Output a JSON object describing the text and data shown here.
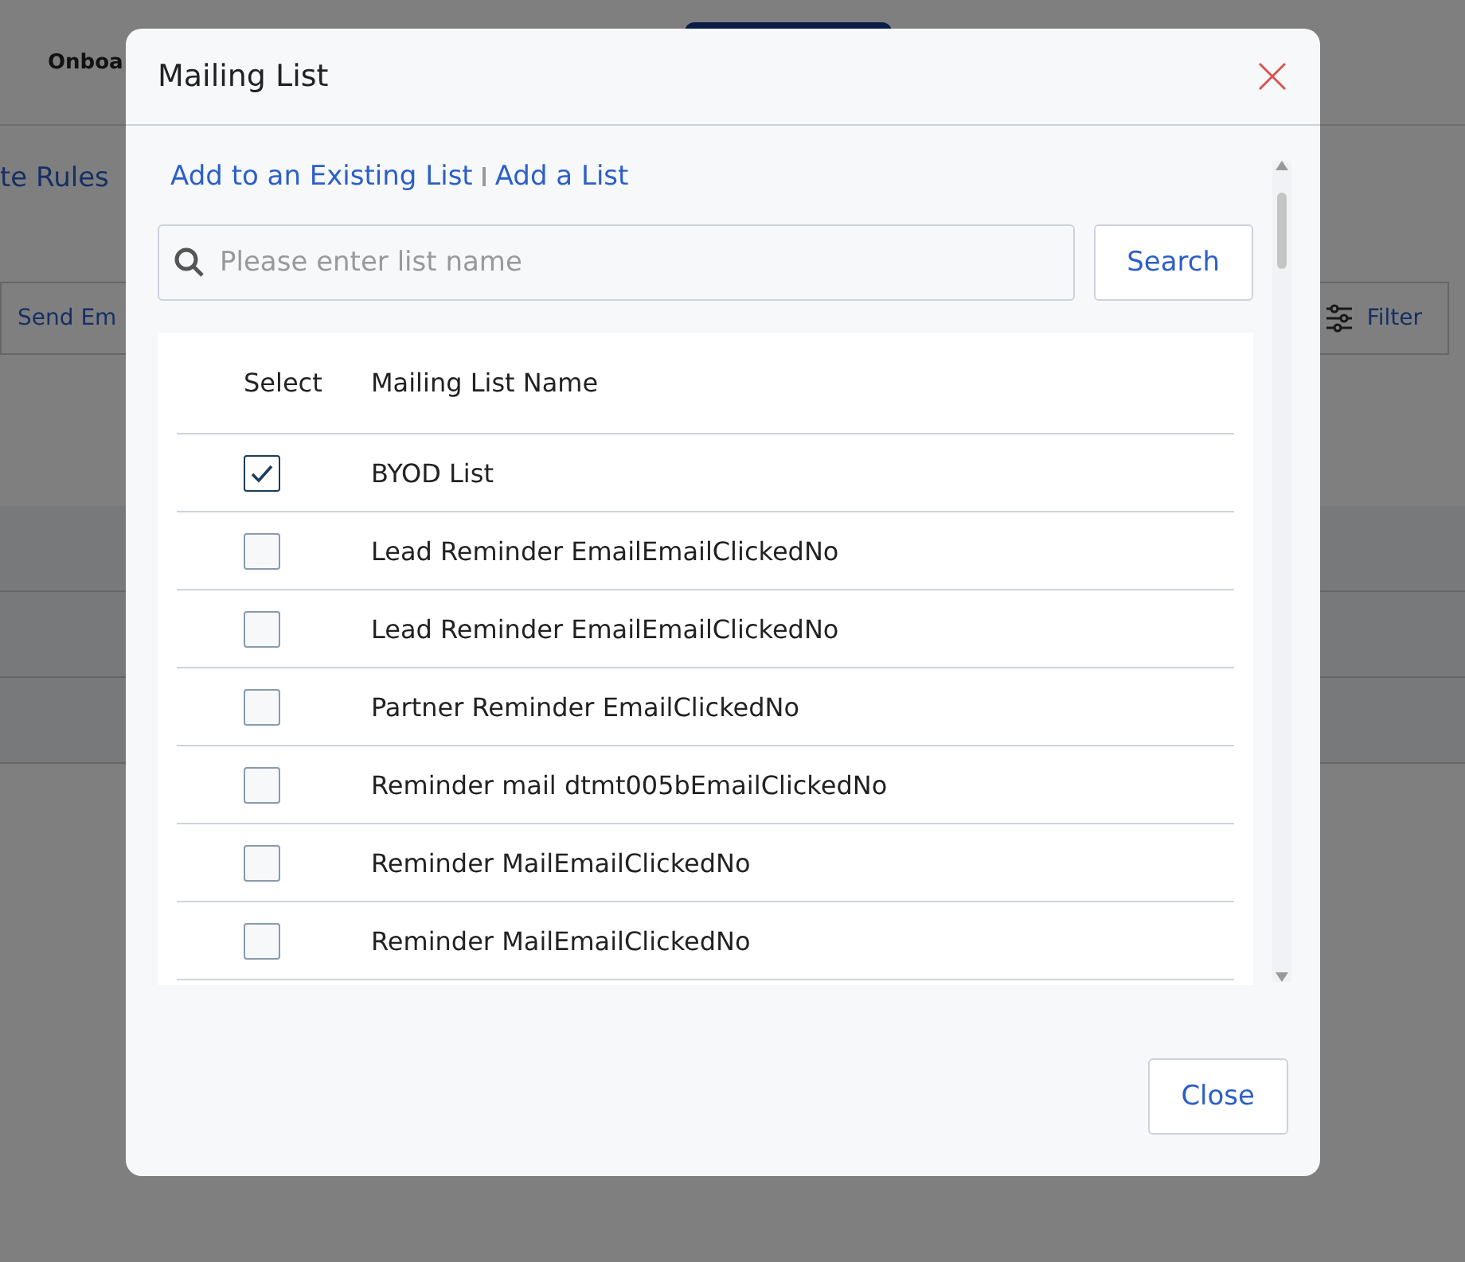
{
  "page": {
    "header_tab": "Onboa",
    "rules_link": "te Rules",
    "send_button": "Send Em",
    "filter_button": "Filter"
  },
  "dialog": {
    "title": "Mailing List",
    "links": [
      "Add to an Existing List",
      "Add a List"
    ],
    "search": {
      "placeholder": "Please enter list name",
      "button": "Search"
    },
    "table": {
      "columns": [
        "Select",
        "Mailing List Name"
      ],
      "rows": [
        {
          "checked": true,
          "name": "BYOD List"
        },
        {
          "checked": false,
          "name": "Lead Reminder EmailEmailClickedNo"
        },
        {
          "checked": false,
          "name": "Lead Reminder EmailEmailClickedNo"
        },
        {
          "checked": false,
          "name": "Partner Reminder EmailClickedNo"
        },
        {
          "checked": false,
          "name": "Reminder mail dtmt005bEmailClickedNo"
        },
        {
          "checked": false,
          "name": "Reminder MailEmailClickedNo"
        },
        {
          "checked": false,
          "name": "Reminder MailEmailClickedNo"
        }
      ]
    },
    "close_button": "Close"
  }
}
